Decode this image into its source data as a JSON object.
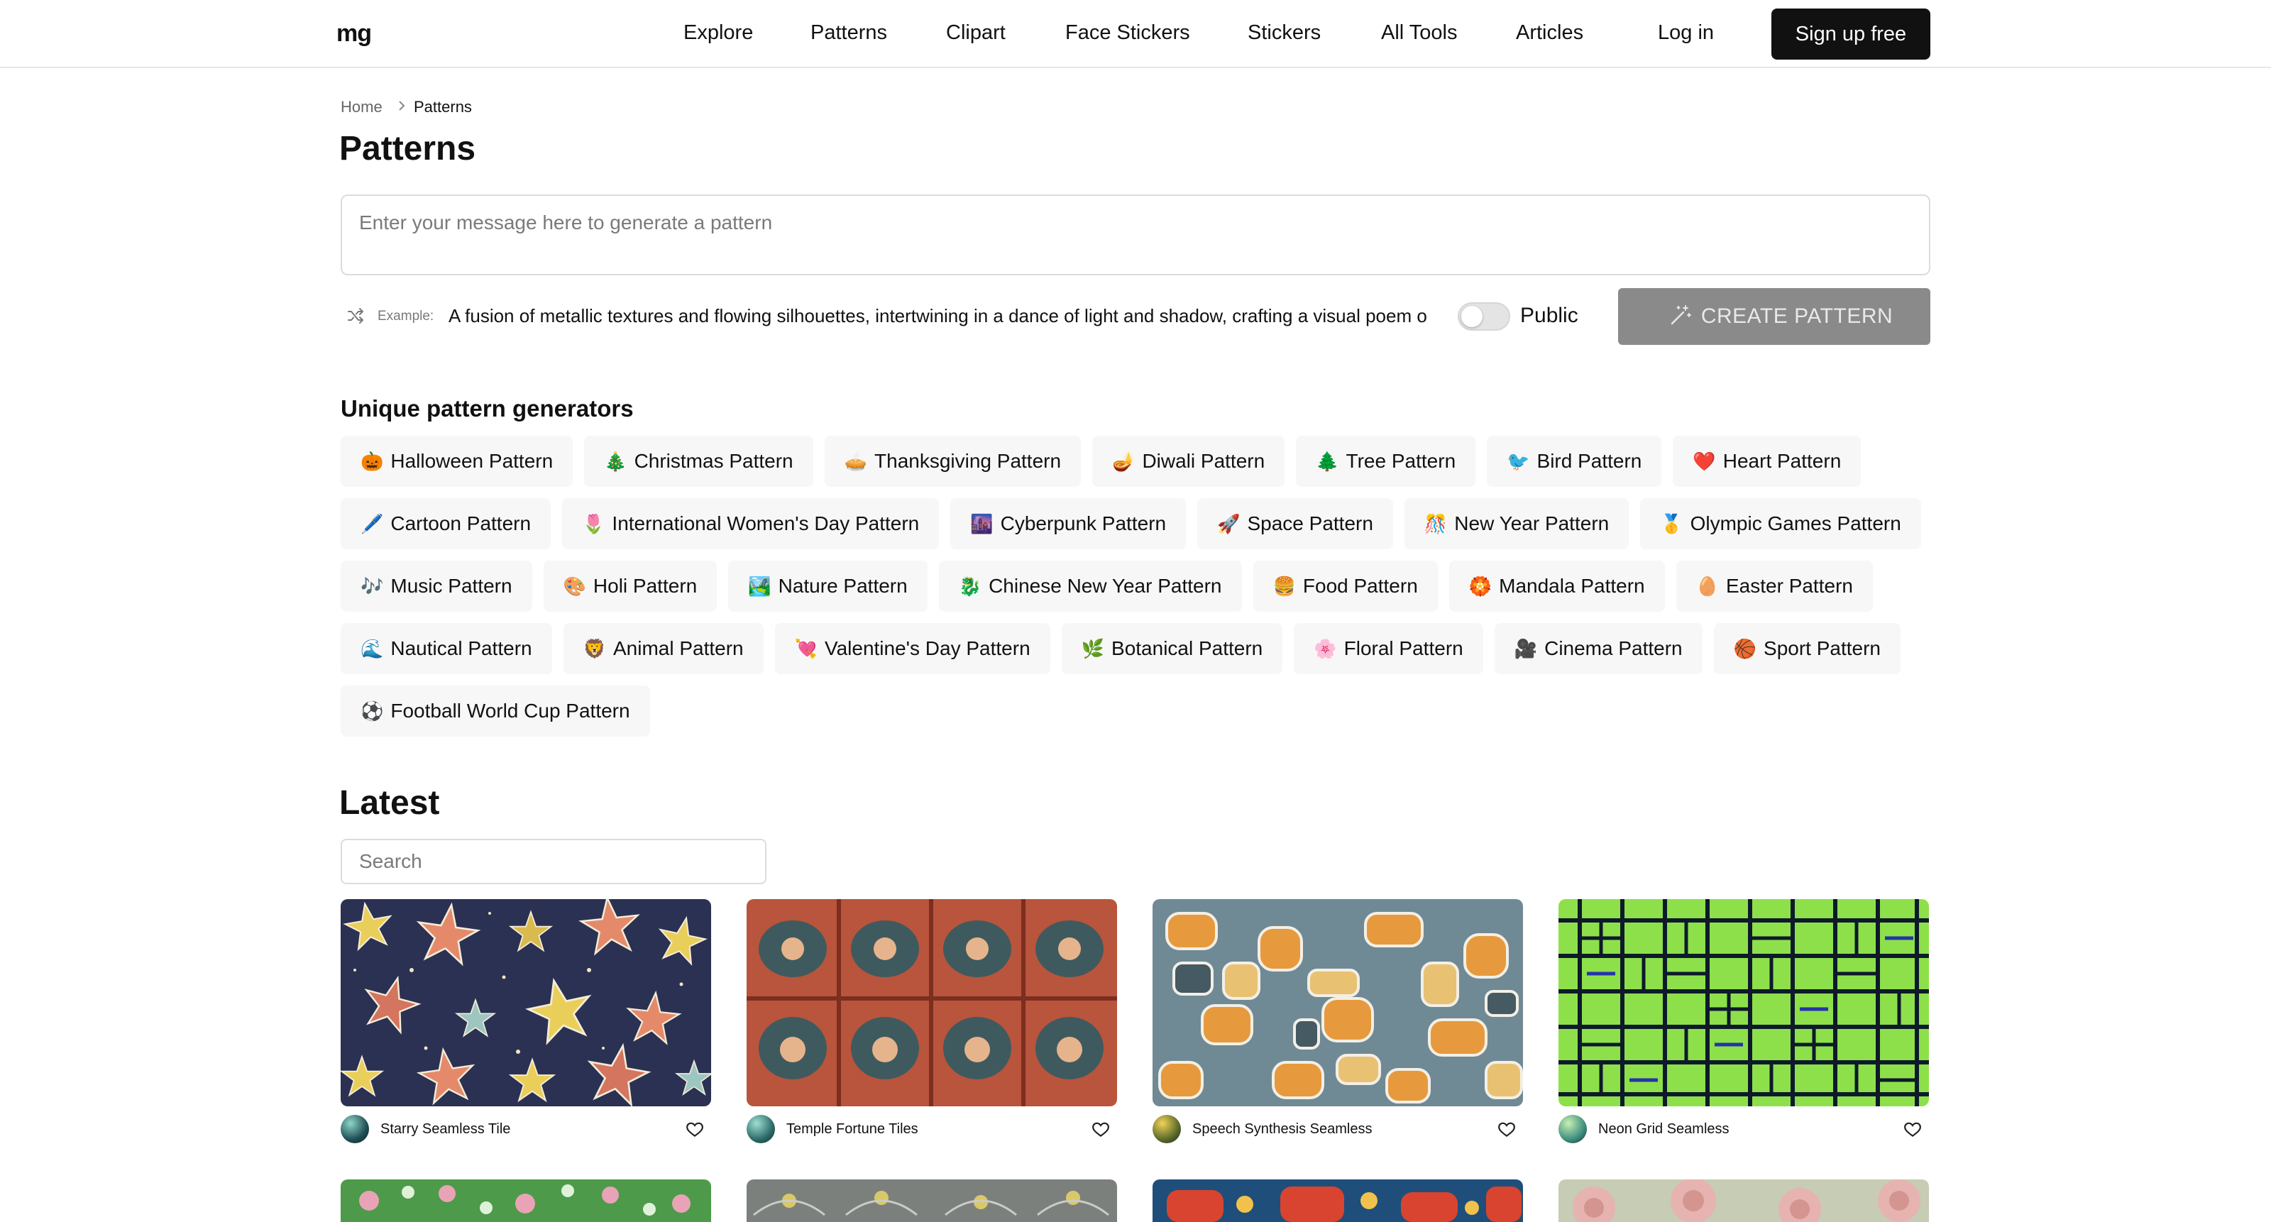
{
  "header": {
    "logo": "mg",
    "nav": [
      "Explore",
      "Patterns",
      "Clipart",
      "Face Stickers",
      "Stickers",
      "All Tools",
      "Articles"
    ],
    "login": "Log in",
    "signup": "Sign up free"
  },
  "breadcrumb": {
    "home": "Home",
    "current": "Patterns"
  },
  "page_title": "Patterns",
  "prompt": {
    "placeholder": "Enter your message here to generate a pattern",
    "example_label": "Example:",
    "example_text": "A fusion of metallic textures and flowing silhouettes, intertwining in a dance of light and shadow, crafting a visual poem of",
    "public_label": "Public",
    "public_on": false,
    "create_label": "CREATE PATTERN"
  },
  "generators": {
    "heading": "Unique pattern generators",
    "items": [
      {
        "emoji": "🎃",
        "label": "Halloween Pattern"
      },
      {
        "emoji": "🎄",
        "label": "Christmas Pattern"
      },
      {
        "emoji": "🥧",
        "label": "Thanksgiving Pattern"
      },
      {
        "emoji": "🪔",
        "label": "Diwali Pattern"
      },
      {
        "emoji": "🌲",
        "label": "Tree Pattern"
      },
      {
        "emoji": "🐦",
        "label": "Bird Pattern"
      },
      {
        "emoji": "❤️",
        "label": "Heart Pattern"
      },
      {
        "emoji": "🖊️",
        "label": "Cartoon Pattern"
      },
      {
        "emoji": "🌷",
        "label": "International Women's Day Pattern"
      },
      {
        "emoji": "🌆",
        "label": "Cyberpunk Pattern"
      },
      {
        "emoji": "🚀",
        "label": "Space Pattern"
      },
      {
        "emoji": "🎊",
        "label": "New Year Pattern"
      },
      {
        "emoji": "🥇",
        "label": "Olympic Games Pattern"
      },
      {
        "emoji": "🎶",
        "label": "Music Pattern"
      },
      {
        "emoji": "🎨",
        "label": "Holi Pattern"
      },
      {
        "emoji": "🏞️",
        "label": "Nature Pattern"
      },
      {
        "emoji": "🐉",
        "label": "Chinese New Year Pattern"
      },
      {
        "emoji": "🍔",
        "label": "Food Pattern"
      },
      {
        "emoji": "🏵️",
        "label": "Mandala Pattern"
      },
      {
        "emoji": "🥚",
        "label": "Easter Pattern"
      },
      {
        "emoji": "🌊",
        "label": "Nautical Pattern"
      },
      {
        "emoji": "🦁",
        "label": "Animal Pattern"
      },
      {
        "emoji": "💘",
        "label": "Valentine's Day Pattern"
      },
      {
        "emoji": "🌿",
        "label": "Botanical Pattern"
      },
      {
        "emoji": "🌸",
        "label": "Floral Pattern"
      },
      {
        "emoji": "🎥",
        "label": "Cinema Pattern"
      },
      {
        "emoji": "🏀",
        "label": "Sport Pattern"
      },
      {
        "emoji": "⚽",
        "label": "Football World Cup Pattern"
      }
    ]
  },
  "latest": {
    "title": "Latest",
    "search_placeholder": "Search",
    "cards": [
      {
        "title": "Starry Seamless Tile"
      },
      {
        "title": "Temple Fortune Tiles"
      },
      {
        "title": "Speech Synthesis Seamless"
      },
      {
        "title": "Neon Grid Seamless"
      }
    ]
  },
  "colors": {
    "primary_button": "#111111",
    "create_button_disabled": "#8a8a8a",
    "chip_bg": "#f7f7f7",
    "border": "#dcdcdc"
  }
}
